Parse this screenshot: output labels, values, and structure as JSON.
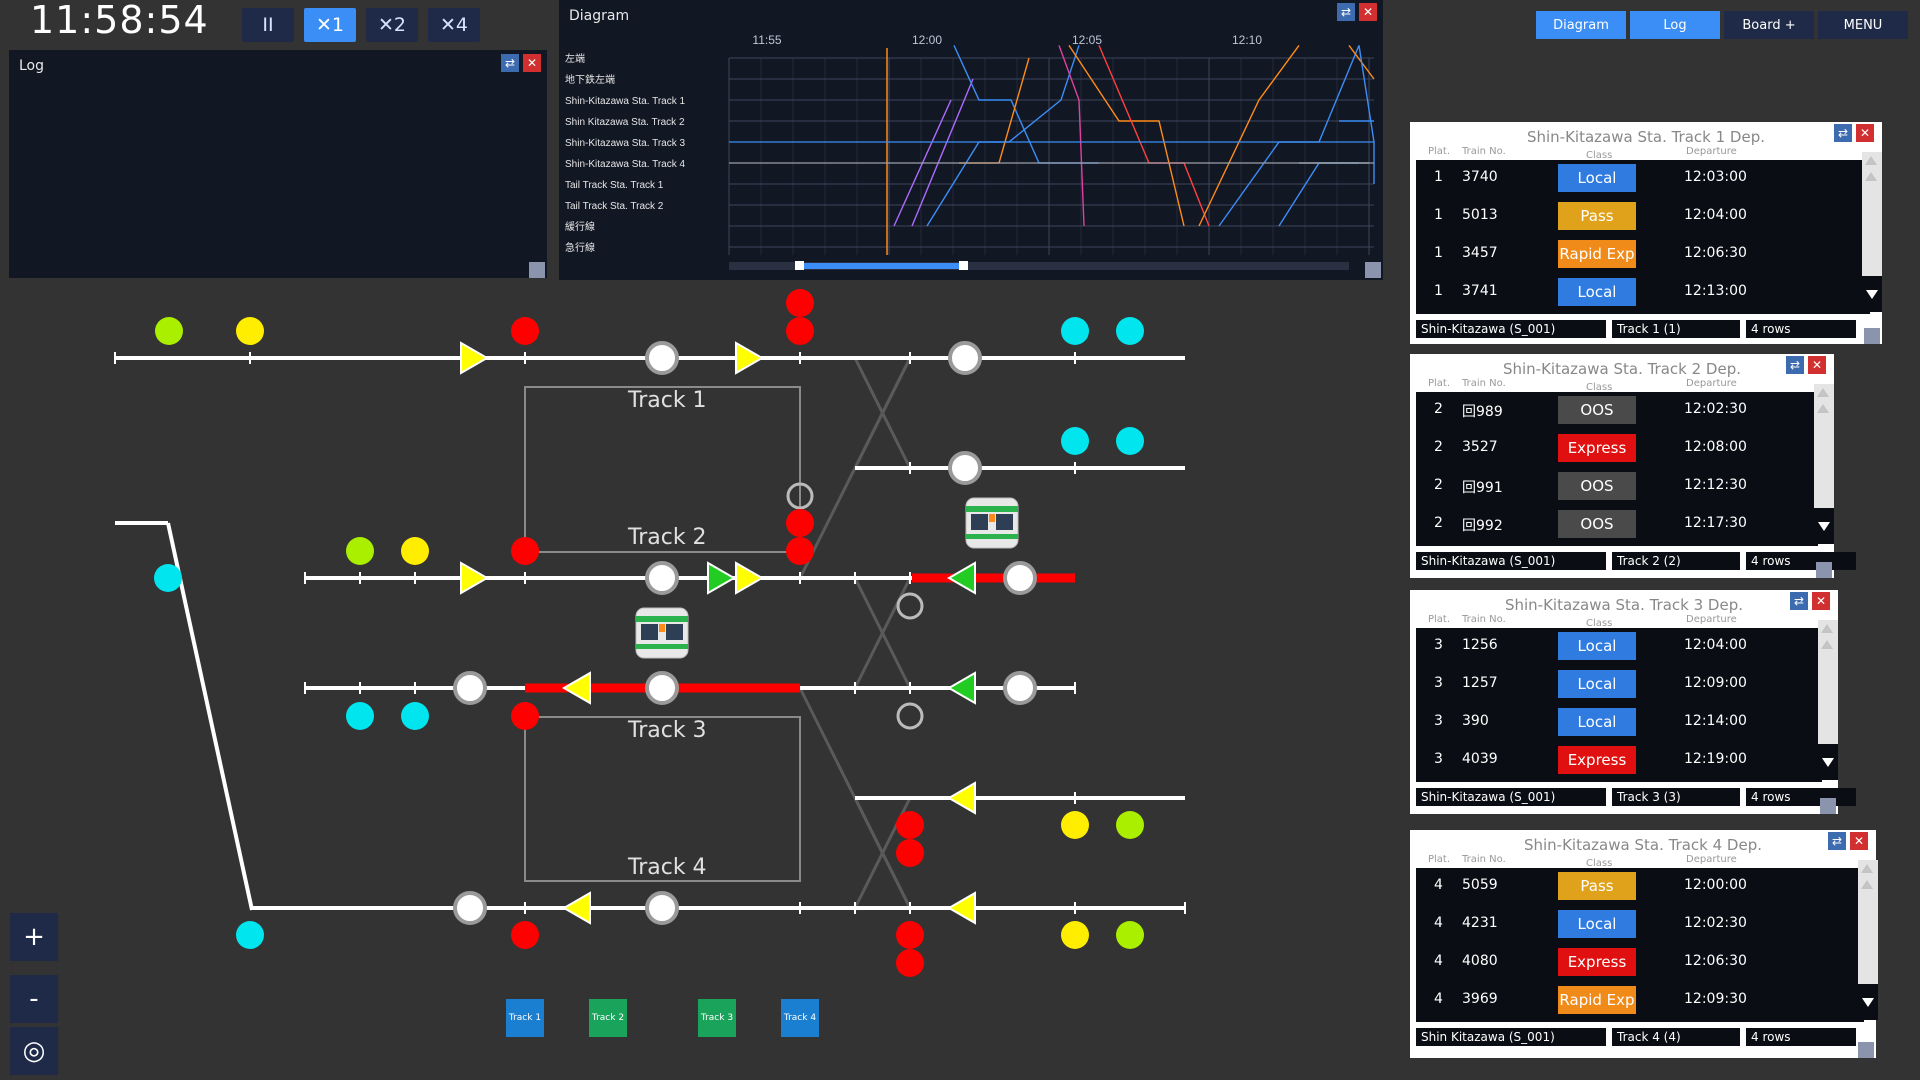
{
  "clock": "11:58:54",
  "speed_buttons": [
    "II",
    "✕1",
    "✕2",
    "✕4"
  ],
  "active_speed_index": 1,
  "top_menu": [
    "Diagram",
    "Log",
    "Board +",
    "MENU"
  ],
  "log_panel": {
    "title": "Log"
  },
  "diagram_panel": {
    "title": "Diagram",
    "time_labels": [
      "11:55",
      "12:00",
      "12:05",
      "12:10"
    ],
    "row_labels": [
      "左端",
      "地下鉄左端",
      "Shin-Kitazawa Sta. Track 1",
      "Shin Kitazawa Sta. Track 2",
      "Shin-Kitazawa Sta. Track 3",
      "Shin-Kitazawa Sta. Track 4",
      "Tail Track Sta. Track 1",
      "Tail Track Sta. Track 2",
      "緩行線",
      "急行線"
    ]
  },
  "track_labels": [
    "Track 1",
    "Track 2",
    "Track 3",
    "Track 4"
  ],
  "bottom_track_buttons": [
    "Track 1",
    "Track 2",
    "Track 3",
    "Track 4"
  ],
  "zoom_buttons": {
    "plus": "+",
    "minus": "-",
    "reset": "◎"
  },
  "boards": [
    {
      "title": "Shin-Kitazawa Sta. Track 1 Dep.",
      "headers": [
        "Plat.",
        "Train No.",
        "Class",
        "Departure"
      ],
      "rows": [
        {
          "plat": "1",
          "train": "3740",
          "class": "Local",
          "dep": "12:03:00"
        },
        {
          "plat": "1",
          "train": "5013",
          "class": "Pass",
          "dep": "12:04:00"
        },
        {
          "plat": "1",
          "train": "3457",
          "class": "Rapid Exp",
          "dep": "12:06:30"
        },
        {
          "plat": "1",
          "train": "3741",
          "class": "Local",
          "dep": "12:13:00"
        }
      ],
      "footer": [
        "Shin-Kitazawa (S_001)",
        "Track 1 (1)",
        "4 rows"
      ]
    },
    {
      "title": "Shin-Kitazawa Sta. Track 2 Dep.",
      "headers": [
        "Plat.",
        "Train No.",
        "Class",
        "Departure"
      ],
      "rows": [
        {
          "plat": "2",
          "train": "回989",
          "class": "OOS",
          "dep": "12:02:30"
        },
        {
          "plat": "2",
          "train": "3527",
          "class": "Express",
          "dep": "12:08:00"
        },
        {
          "plat": "2",
          "train": "回991",
          "class": "OOS",
          "dep": "12:12:30"
        },
        {
          "plat": "2",
          "train": "回992",
          "class": "OOS",
          "dep": "12:17:30"
        }
      ],
      "footer": [
        "Shin-Kitazawa (S_001)",
        "Track 2 (2)",
        "4 rows"
      ]
    },
    {
      "title": "Shin-Kitazawa Sta. Track 3 Dep.",
      "headers": [
        "Plat.",
        "Train No.",
        "Class",
        "Departure"
      ],
      "rows": [
        {
          "plat": "3",
          "train": "1256",
          "class": "Local",
          "dep": "12:04:00"
        },
        {
          "plat": "3",
          "train": "1257",
          "class": "Local",
          "dep": "12:09:00"
        },
        {
          "plat": "3",
          "train": "390",
          "class": "Local",
          "dep": "12:14:00"
        },
        {
          "plat": "3",
          "train": "4039",
          "class": "Express",
          "dep": "12:19:00"
        }
      ],
      "footer": [
        "Shin-Kitazawa (S_001)",
        "Track 3 (3)",
        "4 rows"
      ]
    },
    {
      "title": "Shin-Kitazawa Sta. Track 4 Dep.",
      "headers": [
        "Plat.",
        "Train No.",
        "Class",
        "Departure"
      ],
      "rows": [
        {
          "plat": "4",
          "train": "5059",
          "class": "Pass",
          "dep": "12:00:00"
        },
        {
          "plat": "4",
          "train": "4231",
          "class": "Local",
          "dep": "12:02:30"
        },
        {
          "plat": "4",
          "train": "4080",
          "class": "Express",
          "dep": "12:06:30"
        },
        {
          "plat": "4",
          "train": "3969",
          "class": "Rapid Exp",
          "dep": "12:09:30"
        }
      ],
      "footer": [
        "Shin Kitazawa (S_001)",
        "Track 4 (4)",
        "4 rows"
      ]
    }
  ],
  "class_colors": {
    "Local": "#2f7be0",
    "Pass": "#e0a21a",
    "Rapid Exp": "#f08a18",
    "Express": "#e01010",
    "OOS": "#4a4a4a"
  },
  "colors": {
    "accent": "#3b8ef5",
    "background": "#333333",
    "panel": "#121724"
  }
}
